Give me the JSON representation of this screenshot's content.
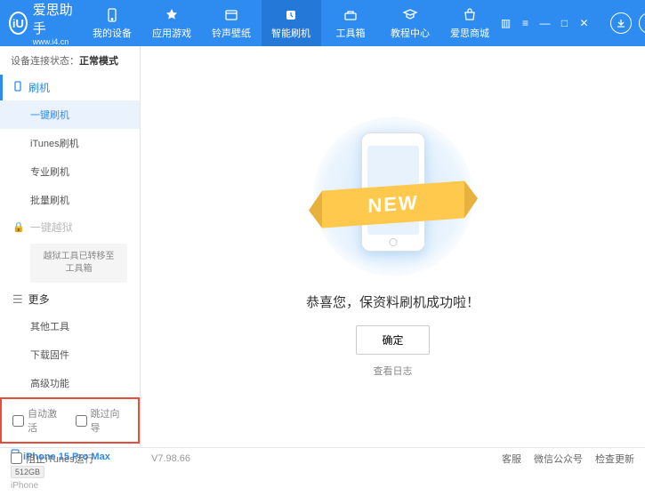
{
  "header": {
    "logo": "爱思助手",
    "logo_sub": "www.i4.cn",
    "logo_glyph": "iU",
    "nav": [
      {
        "label": "我的设备",
        "active": false
      },
      {
        "label": "应用游戏",
        "active": false
      },
      {
        "label": "铃声壁纸",
        "active": false
      },
      {
        "label": "智能刷机",
        "active": true
      },
      {
        "label": "工具箱",
        "active": false
      },
      {
        "label": "教程中心",
        "active": false
      },
      {
        "label": "爱思商城",
        "active": false
      }
    ]
  },
  "sidebar": {
    "conn_label": "设备连接状态：",
    "conn_value": "正常模式",
    "sections": {
      "flash": {
        "title": "刷机",
        "items": [
          "一键刷机",
          "iTunes刷机",
          "专业刷机",
          "批量刷机"
        ],
        "active_idx": 0
      },
      "jailbreak": {
        "title": "一键越狱",
        "note": "越狱工具已转移至工具箱"
      },
      "more": {
        "title": "更多",
        "items": [
          "其他工具",
          "下载固件",
          "高级功能"
        ]
      }
    },
    "checks": {
      "auto_activate": "自动激活",
      "skip_guide": "跳过向导"
    },
    "device": {
      "name": "iPhone 15 Pro Max",
      "storage": "512GB",
      "type": "iPhone"
    }
  },
  "main": {
    "ribbon": "NEW",
    "success": "恭喜您，保资料刷机成功啦！",
    "confirm": "确定",
    "log_link": "查看日志"
  },
  "footer": {
    "block_itunes": "阻止iTunes运行",
    "version": "V7.98.66",
    "links": [
      "客服",
      "微信公众号",
      "检查更新"
    ]
  }
}
